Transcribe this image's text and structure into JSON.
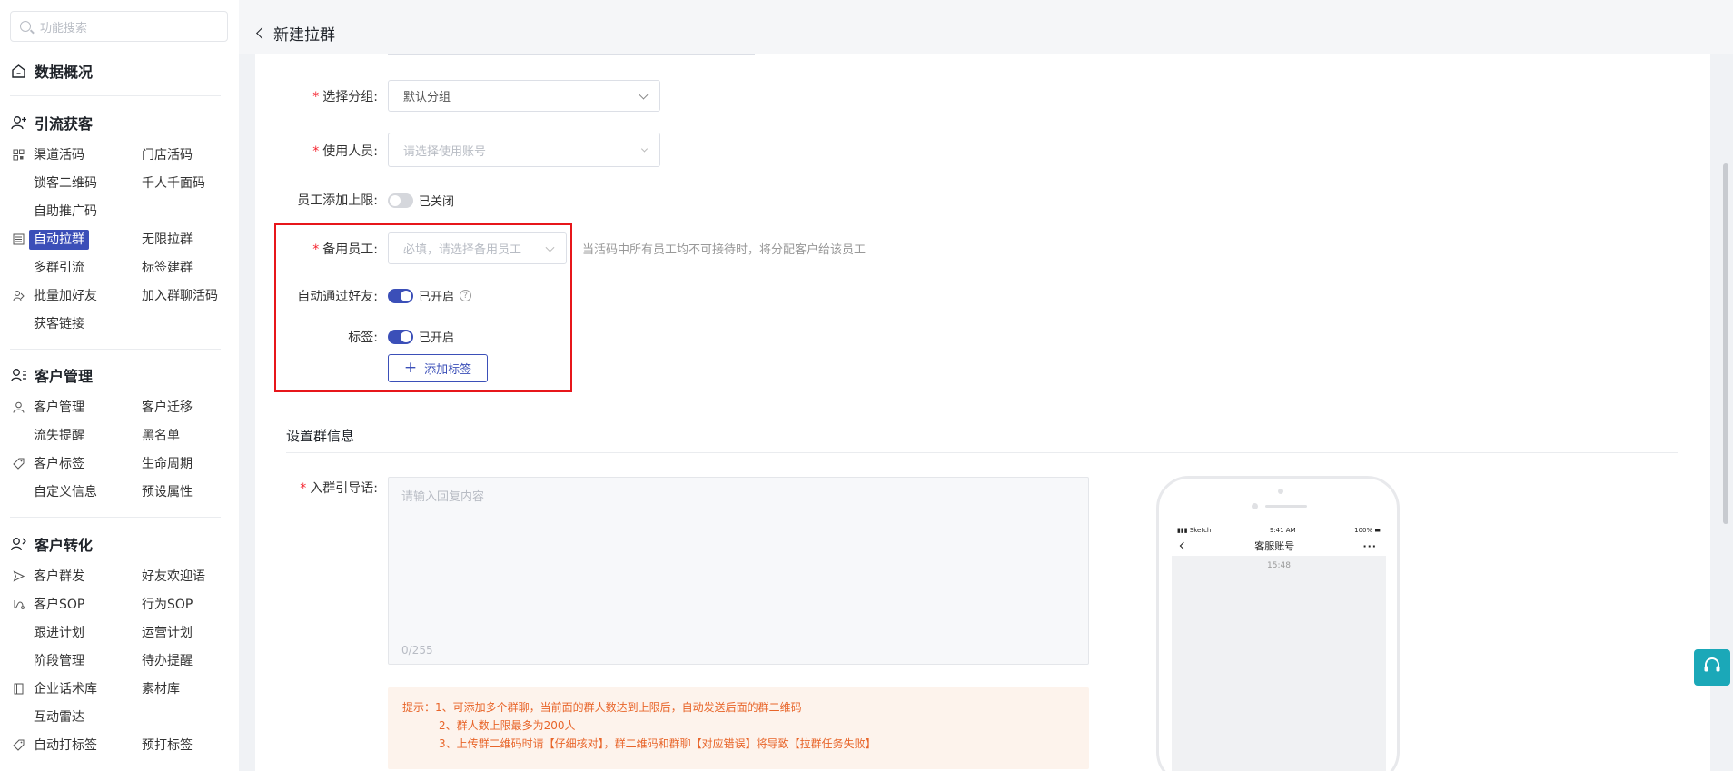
{
  "sidebar": {
    "search_placeholder": "功能搜索",
    "dashboard": "数据概况",
    "sections": {
      "s1": "引流获客",
      "s2": "客户管理",
      "s3": "客户转化"
    },
    "items": {
      "i1": "渠道活码",
      "i2": "门店活码",
      "i3": "锁客二维码",
      "i4": "千人千面码",
      "i5": "自助推广码",
      "i6": "自动拉群",
      "i7": "无限拉群",
      "i8": "多群引流",
      "i9": "标签建群",
      "i10": "批量加好友",
      "i11": "加入群聊活码",
      "i12": "获客链接",
      "i13": "客户管理",
      "i14": "客户迁移",
      "i15": "流失提醒",
      "i16": "黑名单",
      "i17": "客户标签",
      "i18": "生命周期",
      "i19": "自定义信息",
      "i20": "预设属性",
      "i21": "客户群发",
      "i22": "好友欢迎语",
      "i23": "客户SOP",
      "i24": "行为SOP",
      "i25": "跟进计划",
      "i26": "运营计划",
      "i27": "阶段管理",
      "i28": "待办提醒",
      "i29": "企业话术库",
      "i30": "素材库",
      "i31": "互动雷达",
      "i32": "自动打标签",
      "i33": "预打标签"
    }
  },
  "header": {
    "title": "新建拉群"
  },
  "form": {
    "group_label": "选择分组:",
    "group_value": "默认分组",
    "user_label": "使用人员:",
    "user_placeholder": "请选择使用账号",
    "limit_label": "员工添加上限:",
    "limit_status": "已关闭",
    "backup_label": "备用员工:",
    "backup_placeholder": "必填，请选择备用员工",
    "backup_hint": "当活码中所有员工均不可接待时，将分配客户给该员工",
    "auto_label": "自动通过好友:",
    "auto_status": "已开启",
    "tag_label": "标签:",
    "tag_status": "已开启",
    "add_tag": "添加标签"
  },
  "group_info": {
    "title": "设置群信息",
    "guide_label": "入群引导语:",
    "guide_placeholder": "请输入回复内容",
    "guide_count": "0/255",
    "tip1": "提示：1、可添加多个群聊，当前面的群人数达到上限后，自动发送后面的群二维码",
    "tip2": "2、群人数上限最多为200人",
    "tip3": "3、上传群二维码时请【仔细核对】，群二维码和群聊【对应错误】将导致【拉群任务失败】"
  },
  "phone": {
    "carrier": "Sketch",
    "clock": "9:41 AM",
    "battery": "100%",
    "nav_title": "客服账号",
    "chat_time": "15:48"
  },
  "colors": {
    "accent": "#3b4fb8",
    "required": "#f5222d",
    "highlight": "#e7161b",
    "tip": "#e8652a"
  }
}
